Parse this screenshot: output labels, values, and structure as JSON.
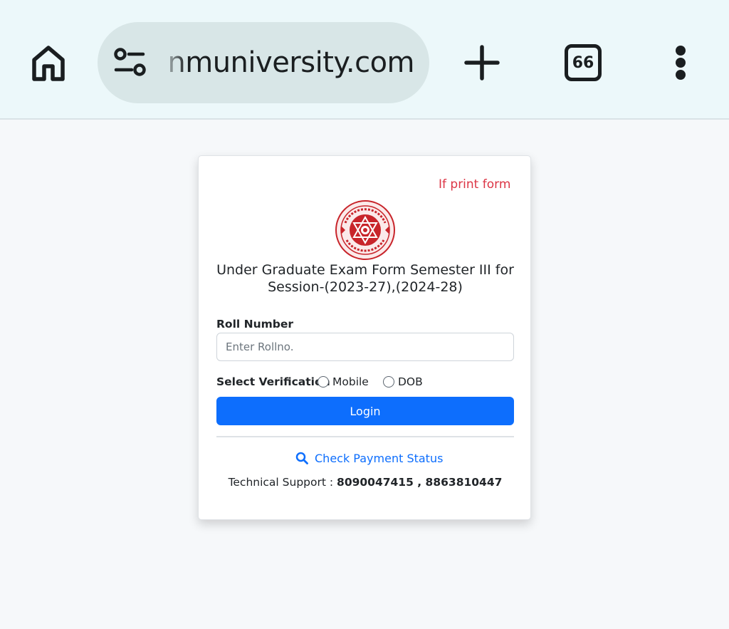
{
  "browser": {
    "url": "nmuniversity.com",
    "tab_count": "66",
    "icons": {
      "home": "home-icon",
      "site_info": "site-settings-icon",
      "new_tab": "plus-icon",
      "menu": "more-vertical-icon"
    }
  },
  "card": {
    "marquee_text": "If print form i",
    "logo": "university-seal",
    "title": "Under Graduate Exam Form Semester III for Session-(2023-27),(2024-28)",
    "roll_label": "Roll Number",
    "roll_placeholder": "Enter Rollno.",
    "roll_value": "",
    "verification_label": "Select Verification",
    "verification_options": [
      "Mobile",
      "DOB"
    ],
    "verification_selected": null,
    "login_label": "Login",
    "payment_link": "Check Payment Status",
    "support_label": "Technical Support :",
    "support_numbers": "8090047415 , 8863810447"
  },
  "colors": {
    "primary": "#0d6efd",
    "marquee": "#dc3545",
    "chrome_bg": "#ecf8fa",
    "seal": "#c8252b"
  }
}
